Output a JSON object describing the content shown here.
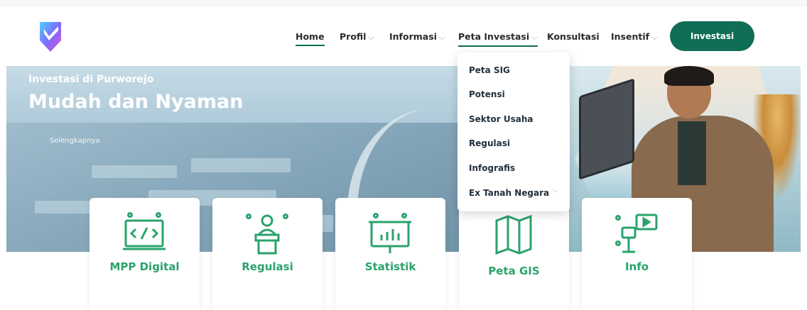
{
  "nav": {
    "items": [
      {
        "label": "Home",
        "has_dropdown": false,
        "active": true
      },
      {
        "label": "Profil",
        "has_dropdown": true,
        "active": false
      },
      {
        "label": "Informasi",
        "has_dropdown": true,
        "active": false
      },
      {
        "label": "Peta Investasi",
        "has_dropdown": true,
        "active": true
      },
      {
        "label": "Konsultasi",
        "has_dropdown": false,
        "active": false
      },
      {
        "label": "Insentif",
        "has_dropdown": true,
        "active": false
      }
    ],
    "chevron": "⌵",
    "cta_label": "Investasi",
    "accent_color": "#0f6e55"
  },
  "hero": {
    "subtitle": "Investasi di Purworejo",
    "title": "Mudah dan Nyaman",
    "more_link": "Selengkapnya"
  },
  "dropdown": {
    "items": [
      "Peta SIG",
      "Potensi",
      "Sektor Usaha",
      "Regulasi",
      "Infografis",
      "Ex Tanah Negara"
    ],
    "submenu_chevron": "⌵"
  },
  "cards": [
    {
      "label": "MPP Digital",
      "icon": "computer-code-icon"
    },
    {
      "label": "Regulasi",
      "icon": "speaker-podium-icon"
    },
    {
      "label": "Statistik",
      "icon": "presentation-chart-icon"
    },
    {
      "label": "Peta GIS",
      "icon": "folded-map-icon"
    },
    {
      "label": "Info",
      "icon": "info-screen-icon"
    }
  ],
  "colors": {
    "card_text": "#2aa36b",
    "icon": "#2aa36b",
    "button": "#0f6e55"
  }
}
